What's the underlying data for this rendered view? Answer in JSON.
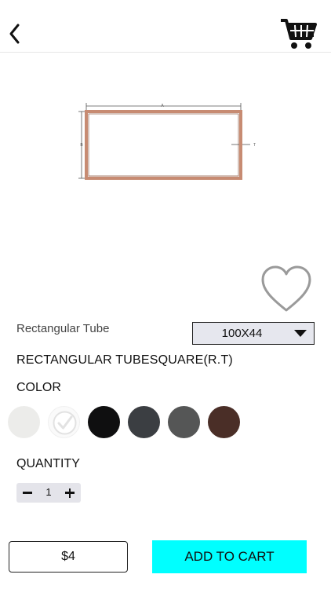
{
  "header": {
    "back_icon": "chevron-left-icon",
    "cart_icon": "shopping-cart-icon"
  },
  "product": {
    "type": "Rectangular Tube",
    "name": "RECTANGULAR TUBESQUARE(R.T)",
    "image_labels": {
      "width_label": "A",
      "height_label": "B",
      "thickness_label": "T"
    },
    "size_select": {
      "selected": "100X44"
    },
    "favorite_icon": "heart-outline-icon"
  },
  "color": {
    "label": "COLOR",
    "swatches": [
      {
        "hex": "#ececea",
        "selected": false
      },
      {
        "hex": "#fafafa",
        "selected": true
      },
      {
        "hex": "#0f0f10",
        "selected": false
      },
      {
        "hex": "#3b3e42",
        "selected": false
      },
      {
        "hex": "#555656",
        "selected": false
      },
      {
        "hex": "#4a2e27",
        "selected": false
      }
    ]
  },
  "quantity": {
    "label": "QUANTITY",
    "value": "1"
  },
  "footer": {
    "price": "$4",
    "add_to_cart_label": "ADD TO CART",
    "accent": "#00ffff"
  }
}
